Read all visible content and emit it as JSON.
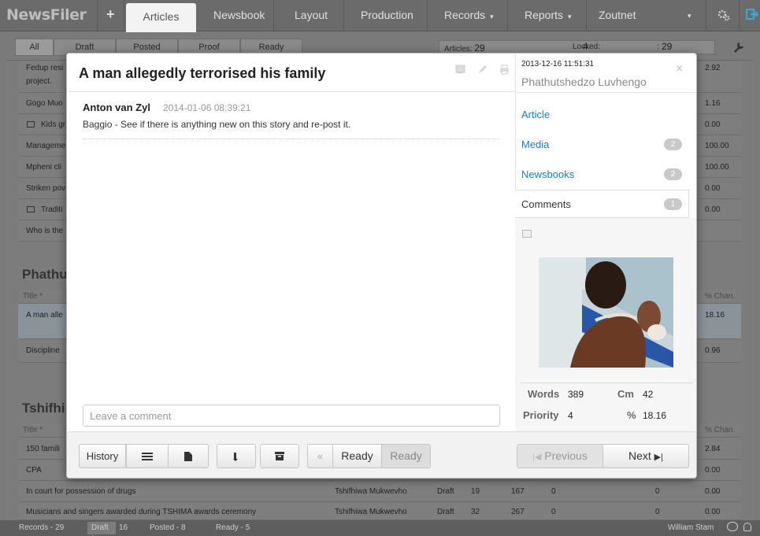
{
  "app": {
    "brand": "NewsFiler"
  },
  "nav": {
    "plus": "+",
    "items": [
      "Articles",
      "Newsbook",
      "Layout",
      "Production",
      "Records",
      "Reports",
      "Zoutnet"
    ],
    "caret": "▾"
  },
  "filters": {
    "tabs": [
      "All",
      "Draft",
      "Posted",
      "Proof",
      "Ready"
    ]
  },
  "counters": {
    "articles_label": "Articles:",
    "articles_value": "29",
    "locked_label": "Locked:",
    "locked_value": "4",
    "extra_label": ":",
    "extra_value": "29"
  },
  "background": {
    "rows_top": [
      {
        "title": "Fedup resi",
        "title2": "project.",
        "pct": "2.92"
      },
      {
        "title": "Gogo Muo",
        "pct": "1.16"
      },
      {
        "title": "Kids gr",
        "pct": "0.00",
        "icon": "image-icon"
      },
      {
        "title": "Manageme",
        "pct": "100.00"
      },
      {
        "title": "Mpheni cli",
        "pct": "100.00"
      },
      {
        "title": "Striken pov",
        "pct": "0.00"
      },
      {
        "title": "Traditi",
        "pct": "0.00",
        "icon": "image-icon"
      },
      {
        "title": "Who is the",
        "pct": ""
      }
    ],
    "section1": {
      "title": "Phathu",
      "head_title": "Title *",
      "head_pct": "% Chan.",
      "rows": [
        {
          "title": "A man alle",
          "pct": "18.16"
        },
        {
          "title": "Discipline",
          "pct": "0.96"
        }
      ]
    },
    "section2": {
      "title": "Tshifhi",
      "head_title": "Title *",
      "head_pct": "% Chan.",
      "rows": [
        {
          "title": "150 famili",
          "pct": "2.84"
        },
        {
          "title": "CPA",
          "pct": "0.00"
        },
        {
          "title": "In court for possession of drugs",
          "author": "Tshifhiwa Mukwevho",
          "status": "Draft",
          "c1": "19",
          "c2": "167",
          "c3": "0",
          "c4": "0",
          "pct": "0.00"
        },
        {
          "title": "Musicians and singers awarded during TSHIMA awards ceremony",
          "author": "Tshifhiwa Mukwevho",
          "status": "Draft",
          "c1": "32",
          "c2": "267",
          "c3": "0",
          "c4": "0",
          "pct": "0.00"
        }
      ]
    }
  },
  "status_bar": {
    "records": "Records - 29",
    "draft_label": "Draft -",
    "draft_value": "16",
    "posted": "Posted - 8",
    "ready": "Ready - 5",
    "user": "William Stam"
  },
  "modal": {
    "title": "A man allegedly terrorised his family",
    "date": "2013-12-16 11:51:31",
    "author_name": "Phathutshedzo Luvhengo",
    "close": "×",
    "comment": {
      "author": "Anton van Zyl",
      "time": "2014-01-06 08:39:21",
      "text": "Baggio - See if there is anything new on this story and re-post it."
    },
    "comment_placeholder": "Leave a comment",
    "sidebar": {
      "article": "Article",
      "media": "Media",
      "media_count": "2",
      "newsbooks": "Newsbooks",
      "newsbooks_count": "2",
      "comments": "Comments",
      "comments_count": "1"
    },
    "stats": {
      "words_label": "Words",
      "words": "389",
      "cm_label": "Cm",
      "cm": "42",
      "priority_label": "Priority",
      "priority": "4",
      "pct_label": "%",
      "pct": "18.16"
    },
    "footer": {
      "history": "History",
      "back": "«",
      "ready_active": "Ready",
      "ready_inactive": "Ready",
      "previous": "Previous",
      "next": "Next"
    }
  },
  "colors": {
    "accent": "#1a7dbd",
    "nav_bg": "#6b6b6b",
    "badge": "#c9c9c9"
  }
}
